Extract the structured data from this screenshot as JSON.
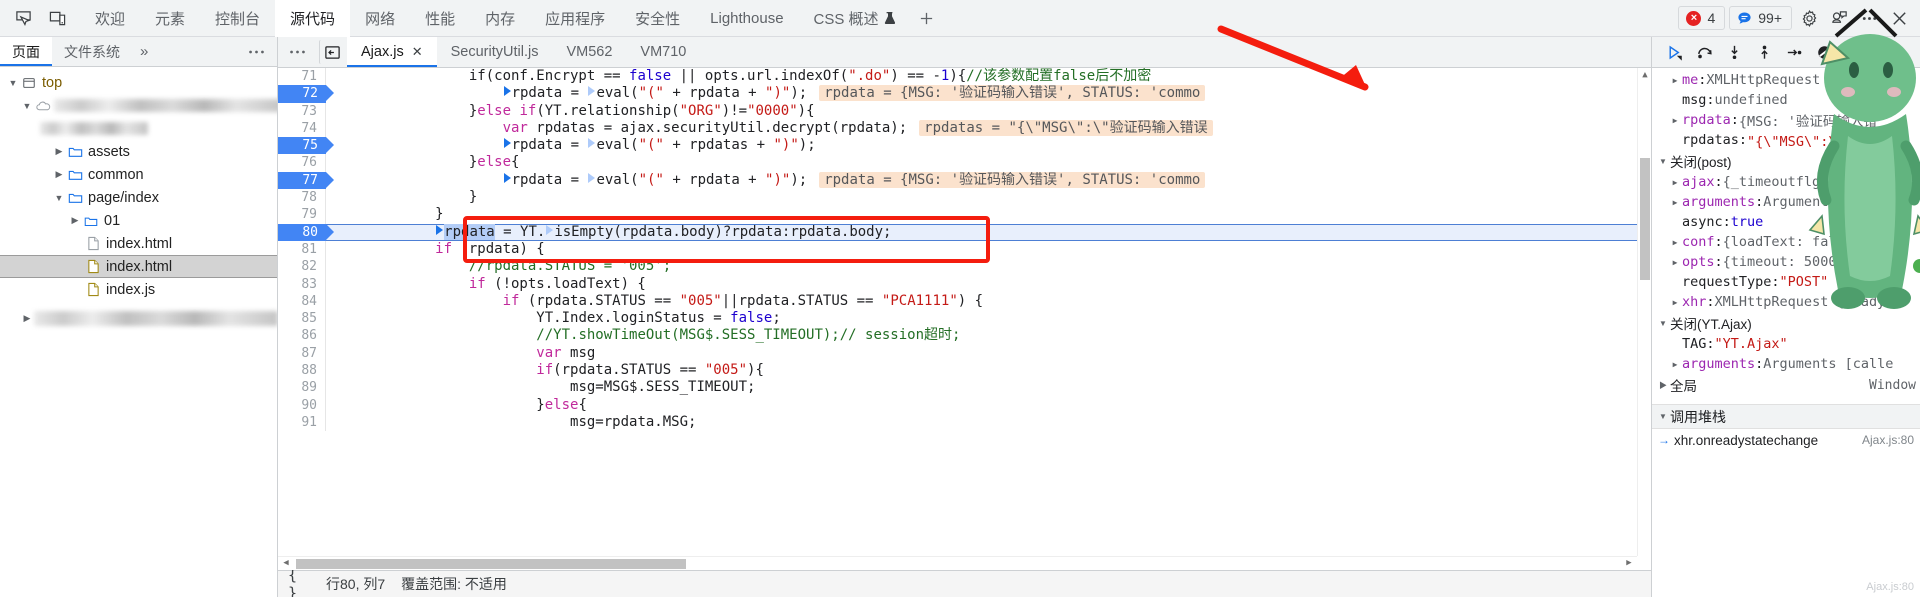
{
  "topbar": {
    "icons": [
      {
        "name": "inspect-element-icon",
        "label": "检查元素"
      },
      {
        "name": "device-toolbar-icon",
        "label": "设备工具栏"
      }
    ],
    "tabs": [
      {
        "label": "欢迎",
        "active": false
      },
      {
        "label": "元素",
        "active": false
      },
      {
        "label": "控制台",
        "active": false
      },
      {
        "label": "源代码",
        "active": true
      },
      {
        "label": "网络",
        "active": false
      },
      {
        "label": "性能",
        "active": false
      },
      {
        "label": "内存",
        "active": false
      },
      {
        "label": "应用程序",
        "active": false
      },
      {
        "label": "安全性",
        "active": false
      },
      {
        "label": "Lighthouse",
        "active": false
      },
      {
        "label": "CSS 概述",
        "active": false,
        "experimental": true
      }
    ],
    "add_tab_label": "+",
    "error_count": "4",
    "message_count": "99+",
    "settings_label": "设置",
    "feedback_label": "反馈",
    "more_label": "更多选项",
    "colors": {
      "error": "#e52222",
      "message": "#1a73e8",
      "accent": "#1a73e8"
    }
  },
  "navigator": {
    "tabs": [
      {
        "label": "页面",
        "active": true
      },
      {
        "label": "文件系统",
        "active": false
      }
    ],
    "more_tabs_label": "»",
    "menu_label": "⋯",
    "tree": [
      {
        "label": "top",
        "depth": 0,
        "twisty": "open",
        "icon": "frame-icon",
        "blurred": false,
        "selected": false
      },
      {
        "label": "",
        "depth": 1,
        "twisty": "open",
        "icon": "cloud-icon",
        "blurred": true,
        "selected": false,
        "blur_width": 232
      },
      {
        "label": "",
        "depth": 2,
        "twisty": "none",
        "icon": "none",
        "blurred": true,
        "selected": false,
        "blur_width": 108
      },
      {
        "label": "assets",
        "depth": 3,
        "twisty": "closed",
        "icon": "folder-icon",
        "blurred": false,
        "selected": false
      },
      {
        "label": "common",
        "depth": 3,
        "twisty": "closed",
        "icon": "folder-icon",
        "blurred": false,
        "selected": false
      },
      {
        "label": "page/index",
        "depth": 3,
        "twisty": "open",
        "icon": "folder-icon",
        "blurred": false,
        "selected": false
      },
      {
        "label": "01",
        "depth": 4,
        "twisty": "closed",
        "icon": "folder-icon",
        "blurred": false,
        "selected": false
      },
      {
        "label": "index.html",
        "depth": 5,
        "twisty": "none",
        "icon": "file-icon-gray",
        "blurred": false,
        "selected": false
      },
      {
        "label": "index.html",
        "depth": 5,
        "twisty": "none",
        "icon": "file-icon-gold",
        "blurred": false,
        "selected": true
      },
      {
        "label": "index.js",
        "depth": 5,
        "twisty": "none",
        "icon": "file-icon-gold",
        "blurred": false,
        "selected": false
      },
      {
        "label": "",
        "depth": 1,
        "twisty": "closed",
        "icon": "none",
        "blurred": true,
        "selected": false,
        "blur_width": 248
      }
    ]
  },
  "editor": {
    "toolbar_menu_label": "⋯",
    "show_navigator_label": "显示导航器",
    "tabs": [
      {
        "label": "Ajax.js",
        "active": true,
        "closable": true
      },
      {
        "label": "SecurityUtil.js",
        "active": false,
        "closable": false
      },
      {
        "label": "VM562",
        "active": false,
        "closable": false
      },
      {
        "label": "VM710",
        "active": false,
        "closable": false
      }
    ],
    "close_label": "✕",
    "first_line": 71,
    "current_line": 80,
    "breakpoint_lines": [
      72,
      75,
      77
    ],
    "lines": [
      {
        "n": 71,
        "segments": [
          {
            "t": "                ",
            "c": "pl"
          },
          {
            "t": "if",
            "c": "pl"
          },
          {
            "t": "(conf.Encrypt == ",
            "c": "pl"
          },
          {
            "t": "false",
            "c": "num"
          },
          {
            "t": " || opts.url.indexOf(",
            "c": "pl"
          },
          {
            "t": "\".do\"",
            "c": "str"
          },
          {
            "t": ") == -",
            "c": "pl"
          },
          {
            "t": "1",
            "c": "num"
          },
          {
            "t": "){",
            "c": "pl"
          },
          {
            "t": "//该参数配置false后不加密",
            "c": "cmt"
          }
        ]
      },
      {
        "n": 72,
        "segments": [
          {
            "t": "                    ",
            "c": "pl"
          },
          {
            "t": "▶",
            "c": "tri"
          },
          {
            "t": "rpdata = ",
            "c": "pl"
          },
          {
            "t": "▷",
            "c": "tri-light"
          },
          {
            "t": "eval(",
            "c": "pl"
          },
          {
            "t": "\"(\"",
            "c": "str"
          },
          {
            "t": " + rpdata + ",
            "c": "pl"
          },
          {
            "t": "\")\"",
            "c": "str"
          },
          {
            "t": ");",
            "c": "pl"
          }
        ],
        "inline_value": "rpdata = {MSG: '验证码输入错误', STATUS: 'commo"
      },
      {
        "n": 73,
        "segments": [
          {
            "t": "                ",
            "c": "pl"
          },
          {
            "t": "}",
            "c": "pl"
          },
          {
            "t": "else",
            "c": "kw"
          },
          {
            "t": " ",
            "c": "pl"
          },
          {
            "t": "if",
            "c": "kw"
          },
          {
            "t": "(YT.relationship(",
            "c": "pl"
          },
          {
            "t": "\"ORG\"",
            "c": "str"
          },
          {
            "t": ")!=",
            "c": "pl"
          },
          {
            "t": "\"0000\"",
            "c": "str"
          },
          {
            "t": "){",
            "c": "pl"
          }
        ]
      },
      {
        "n": 74,
        "segments": [
          {
            "t": "                    ",
            "c": "pl"
          },
          {
            "t": "var",
            "c": "kw"
          },
          {
            "t": " rpdatas = ajax.securityUtil.decrypt(rpdata);",
            "c": "pl"
          }
        ],
        "inline_value": "rpdatas = \"{\\\"MSG\\\":\\\"验证码输入错误"
      },
      {
        "n": 75,
        "segments": [
          {
            "t": "                    ",
            "c": "pl"
          },
          {
            "t": "▶",
            "c": "tri"
          },
          {
            "t": "rpdata = ",
            "c": "pl"
          },
          {
            "t": "▷",
            "c": "tri-light"
          },
          {
            "t": "eval(",
            "c": "pl"
          },
          {
            "t": "\"(\"",
            "c": "str"
          },
          {
            "t": " + rpdatas + ",
            "c": "pl"
          },
          {
            "t": "\")\"",
            "c": "str"
          },
          {
            "t": ");",
            "c": "pl"
          }
        ]
      },
      {
        "n": 76,
        "segments": [
          {
            "t": "                ",
            "c": "pl"
          },
          {
            "t": "}",
            "c": "pl"
          },
          {
            "t": "else",
            "c": "kw"
          },
          {
            "t": "{",
            "c": "pl"
          }
        ]
      },
      {
        "n": 77,
        "segments": [
          {
            "t": "                    ",
            "c": "pl"
          },
          {
            "t": "▶",
            "c": "tri"
          },
          {
            "t": "rpdata = ",
            "c": "pl"
          },
          {
            "t": "▷",
            "c": "tri-light"
          },
          {
            "t": "eval(",
            "c": "pl"
          },
          {
            "t": "\"(\"",
            "c": "str"
          },
          {
            "t": " + rpdata + ",
            "c": "pl"
          },
          {
            "t": "\")\"",
            "c": "str"
          },
          {
            "t": ");",
            "c": "pl"
          }
        ],
        "inline_value": "rpdata = {MSG: '验证码输入错误', STATUS: 'commo"
      },
      {
        "n": 78,
        "segments": [
          {
            "t": "                ",
            "c": "pl"
          },
          {
            "t": "}",
            "c": "pl"
          }
        ]
      },
      {
        "n": 79,
        "segments": [
          {
            "t": "            ",
            "c": "pl"
          },
          {
            "t": "}",
            "c": "pl"
          }
        ]
      },
      {
        "n": 80,
        "segments": [
          {
            "t": "            ",
            "c": "pl"
          },
          {
            "t": "▶",
            "c": "tri"
          },
          {
            "t": "rpdata",
            "c": "sel"
          },
          {
            "t": " = YT.",
            "c": "pl"
          },
          {
            "t": "▷",
            "c": "tri-light"
          },
          {
            "t": "isEmpty(rpdata.body)?rpdata:rpdata.body;",
            "c": "pl"
          }
        ],
        "current": true
      },
      {
        "n": 81,
        "segments": [
          {
            "t": "            ",
            "c": "pl"
          },
          {
            "t": "if",
            "c": "kw"
          },
          {
            "t": " (rpdata) {",
            "c": "pl"
          }
        ]
      },
      {
        "n": 82,
        "segments": [
          {
            "t": "                ",
            "c": "pl"
          },
          {
            "t": "//rpdata.STATUS = '005';",
            "c": "cmt"
          }
        ]
      },
      {
        "n": 83,
        "segments": [
          {
            "t": "                ",
            "c": "pl"
          },
          {
            "t": "if",
            "c": "kw"
          },
          {
            "t": " (!opts.loadText) {",
            "c": "pl"
          }
        ]
      },
      {
        "n": 84,
        "segments": [
          {
            "t": "                    ",
            "c": "pl"
          },
          {
            "t": "if",
            "c": "kw"
          },
          {
            "t": " (rpdata.STATUS == ",
            "c": "pl"
          },
          {
            "t": "\"005\"",
            "c": "str"
          },
          {
            "t": "||rpdata.STATUS == ",
            "c": "pl"
          },
          {
            "t": "\"PCA1111\"",
            "c": "str"
          },
          {
            "t": ") {",
            "c": "pl"
          }
        ]
      },
      {
        "n": 85,
        "segments": [
          {
            "t": "                        ",
            "c": "pl"
          },
          {
            "t": "YT.Index.loginStatus = ",
            "c": "pl"
          },
          {
            "t": "false",
            "c": "num"
          },
          {
            "t": ";",
            "c": "pl"
          }
        ]
      },
      {
        "n": 86,
        "segments": [
          {
            "t": "                        ",
            "c": "pl"
          },
          {
            "t": "//YT.showTimeOut(MSG$.SESS_TIMEOUT);// session超时;",
            "c": "cmt"
          }
        ]
      },
      {
        "n": 87,
        "segments": [
          {
            "t": "                        ",
            "c": "pl"
          },
          {
            "t": "var",
            "c": "kw"
          },
          {
            "t": " msg",
            "c": "pl"
          }
        ]
      },
      {
        "n": 88,
        "segments": [
          {
            "t": "                        ",
            "c": "pl"
          },
          {
            "t": "if",
            "c": "kw"
          },
          {
            "t": "(rpdata.STATUS == ",
            "c": "pl"
          },
          {
            "t": "\"005\"",
            "c": "str"
          },
          {
            "t": "){",
            "c": "pl"
          }
        ]
      },
      {
        "n": 89,
        "segments": [
          {
            "t": "                            ",
            "c": "pl"
          },
          {
            "t": "msg=MSG$.SESS_TIMEOUT;",
            "c": "pl"
          }
        ]
      },
      {
        "n": 90,
        "segments": [
          {
            "t": "                        ",
            "c": "pl"
          },
          {
            "t": "}",
            "c": "pl"
          },
          {
            "t": "else",
            "c": "kw"
          },
          {
            "t": "{",
            "c": "pl"
          }
        ]
      },
      {
        "n": 91,
        "segments": [
          {
            "t": "                            ",
            "c": "pl"
          },
          {
            "t": "msg=rpdata.MSG;",
            "c": "pl"
          }
        ]
      }
    ],
    "status": {
      "pretty_print_label": "{ }",
      "cursor": "行80, 列7",
      "coverage": "覆盖范围: 不适用"
    }
  },
  "debugger": {
    "toolbar": [
      {
        "name": "resume-button",
        "label": "继续执行脚本"
      },
      {
        "name": "step-over-button",
        "label": "跳过下一个函数调用"
      },
      {
        "name": "step-into-button",
        "label": "进入下一个函数调用"
      },
      {
        "name": "step-out-button",
        "label": "跳出当前函数"
      },
      {
        "name": "step-button",
        "label": "执行单步"
      },
      {
        "name": "deactivate-breakpoints-button",
        "label": "停用断点"
      },
      {
        "name": "pause-on-exceptions-button",
        "label": "出现异常时暂停"
      }
    ],
    "scope_rows": [
      {
        "twisty": "closed",
        "name": "me",
        "value": "XMLHttpRequest {readyS",
        "vkind": "obj",
        "indent": 1
      },
      {
        "twisty": "none",
        "name": "msg",
        "value": "undefined",
        "vkind": "obj",
        "indent": 1
      },
      {
        "twisty": "closed",
        "name": "rpdata",
        "value": "{MSG: '验证码输入错",
        "vkind": "obj",
        "indent": 1
      },
      {
        "twisty": "none",
        "name": "rpdatas",
        "value": "\"{\\\"MSG\\\":\\\"验证码输",
        "vkind": "str",
        "indent": 1
      }
    ],
    "sections": [
      {
        "title": "关闭(post)",
        "open": true,
        "rows": [
          {
            "twisty": "closed",
            "name": "ajax",
            "value": "{_timeoutflg: false, c",
            "vkind": "obj",
            "indent": 1
          },
          {
            "twisty": "closed",
            "name": "arguments",
            "value": "Arguments [{…}, ",
            "vkind": "obj",
            "indent": 1
          },
          {
            "twisty": "none",
            "name": "async",
            "value": "true",
            "vkind": "bool",
            "indent": 1
          },
          {
            "twisty": "closed",
            "name": "conf",
            "value": "{loadText: false, med",
            "vkind": "obj",
            "indent": 1
          },
          {
            "twisty": "closed",
            "name": "opts",
            "value": "{timeout: 50000, show",
            "vkind": "obj",
            "indent": 1
          },
          {
            "twisty": "none",
            "name": "requestType",
            "value": "\"POST\"",
            "vkind": "str",
            "indent": 1
          },
          {
            "twisty": "closed",
            "name": "xhr",
            "value": "XMLHttpRequest {readyS",
            "vkind": "obj",
            "indent": 1
          }
        ]
      },
      {
        "title": "关闭(YT.Ajax)",
        "open": true,
        "rows": [
          {
            "twisty": "none",
            "name": "TAG",
            "value": "\"YT.Ajax\"",
            "vkind": "str",
            "indent": 1
          },
          {
            "twisty": "closed",
            "name": "arguments",
            "value": "Arguments [calle",
            "vkind": "obj",
            "indent": 1
          }
        ]
      },
      {
        "title": "全局",
        "open": false,
        "global_value": "Window",
        "rows": []
      }
    ],
    "call_stack": {
      "title": "调用堆栈",
      "frames": [
        {
          "fn": "xhr.onreadystatechange",
          "loc": "Ajax.js:80",
          "selected": true
        }
      ]
    }
  },
  "annotations": {
    "red_box_label": "highlighted-code-line",
    "red_arrow_label": "step-into-pointer",
    "colors": {
      "annotation": "#f41d0e"
    }
  },
  "watermark": {
    "text": "Ajax.js:80"
  }
}
